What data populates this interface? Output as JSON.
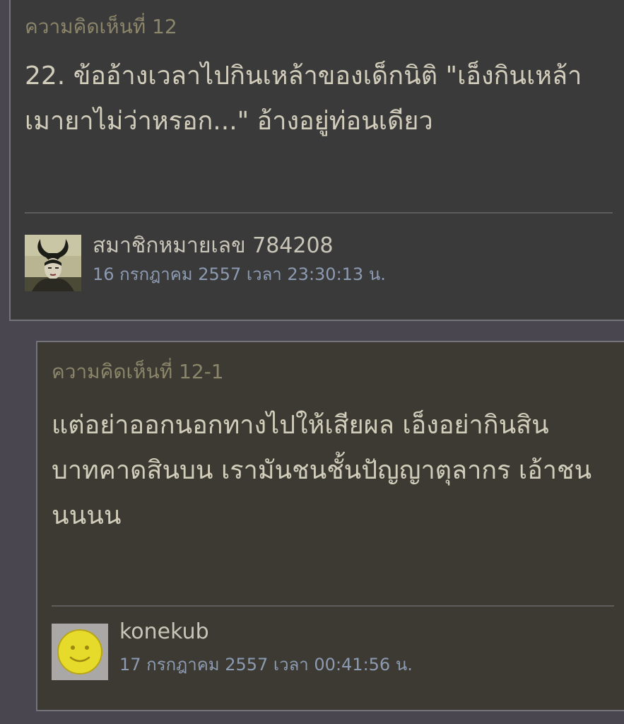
{
  "comments": [
    {
      "header": "ความคิดเห็นที่ 12",
      "body": "22. ข้ออ้างเวลาไปกินเหล้าของเด็กนิติ \"เอ็งกินเหล้า\nเมายาไม่ว่าหรอก...\" อ้างอยู่ท่อนเดียว",
      "author": "สมาชิกหมายเลข 784208",
      "timestamp": "16 กรกฎาคม 2557 เวลา 23:30:13 น.",
      "avatar_icon": "horned-figure-avatar-icon"
    },
    {
      "header": "ความคิดเห็นที่ 12-1",
      "body": "แต่อย่าออกนอกทางไปให้เสียผล เอ็งอย่ากินสิน\nบาทคาดสินบน เรามันชนชั้นปัญญาตุลากร เอ้าชน\nนนนน",
      "author": "konekub",
      "timestamp": "17 กรกฎาคม 2557 เวลา 00:41:56 น.",
      "avatar_icon": "smiley-face-avatar-icon"
    }
  ],
  "colors": {
    "page_background": "#4a4650",
    "main_card_background": "#3a3a3a",
    "reply_card_background": "#3c3a33",
    "header_text": "#8b8569",
    "body_text": "#d2cdbb",
    "timestamp_text": "#8c9bb1",
    "smiley_yellow": "#e6da2a"
  }
}
